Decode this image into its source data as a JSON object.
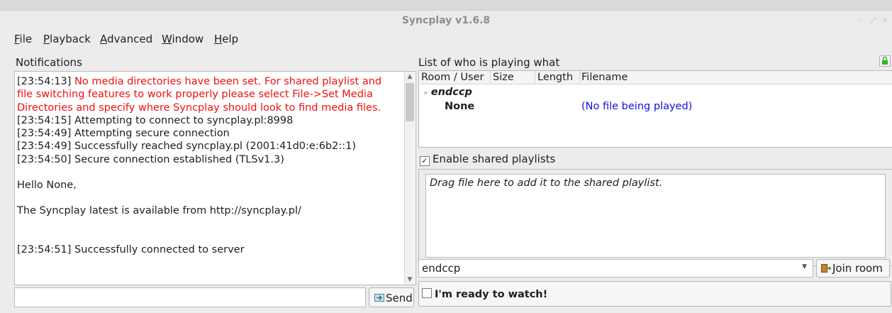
{
  "window": {
    "title": "Syncplay v1.6.8"
  },
  "menu": [
    {
      "label": "File",
      "ul": "F",
      "rest": "ile"
    },
    {
      "label": "Playback",
      "ul": "P",
      "rest": "layback"
    },
    {
      "label": "Advanced",
      "ul": "A",
      "rest": "dvanced"
    },
    {
      "label": "Window",
      "ul": "W",
      "rest": "indow"
    },
    {
      "label": "Help",
      "ul": "H",
      "rest": "elp"
    }
  ],
  "notifications": {
    "title": "Notifications",
    "lines": [
      {
        "ts": "[23:54:13]",
        "text": " No media directories have been set. For shared playlist and",
        "red": true
      },
      {
        "ts": "",
        "text": "file switching features to work properly please select File->Set Media",
        "red": true
      },
      {
        "ts": "",
        "text": "Directories and specify where Syncplay should look to find media files.",
        "red": true
      },
      {
        "ts": "",
        "text": "[23:54:15] Attempting to connect to syncplay.pl:8998",
        "red": false
      },
      {
        "ts": "",
        "text": "[23:54:49] Attempting secure connection",
        "red": false
      },
      {
        "ts": "",
        "text": "[23:54:49] Successfully reached syncplay.pl (2001:41d0:e:6b2::1)",
        "red": false
      },
      {
        "ts": "",
        "text": "[23:54:50] Secure connection established (TLSv1.3)",
        "red": false
      },
      {
        "ts": "",
        "text": "",
        "red": false
      },
      {
        "ts": "",
        "text": "Hello None,",
        "red": false
      },
      {
        "ts": "",
        "text": "",
        "red": false
      },
      {
        "ts": "",
        "text": "The Syncplay latest is available from http://syncplay.pl/",
        "red": false
      },
      {
        "ts": "",
        "text": "",
        "red": false
      },
      {
        "ts": "",
        "text": "",
        "red": false
      },
      {
        "ts": "",
        "text": "[23:54:51] Successfully connected to server",
        "red": false
      }
    ]
  },
  "chat": {
    "input_value": "",
    "send_label": "Send"
  },
  "playing": {
    "title": "List of who is playing what",
    "columns": [
      "Room / User",
      "Size",
      "Length",
      "Filename"
    ],
    "room": "endccp",
    "user": "None",
    "file": "(No file being played)"
  },
  "shared_playlist": {
    "enable_label": "Enable shared playlists",
    "enabled": true,
    "placeholder": "Drag file here to add it to the shared playlist."
  },
  "room_selector": {
    "value": "endccp",
    "join_label": "Join room"
  },
  "ready": {
    "label": "I'm ready to watch!",
    "checked": false
  },
  "colors": {
    "alert_red": "#f01010",
    "link_blue": "#1010e0",
    "lock_green": "#2fb52f"
  }
}
